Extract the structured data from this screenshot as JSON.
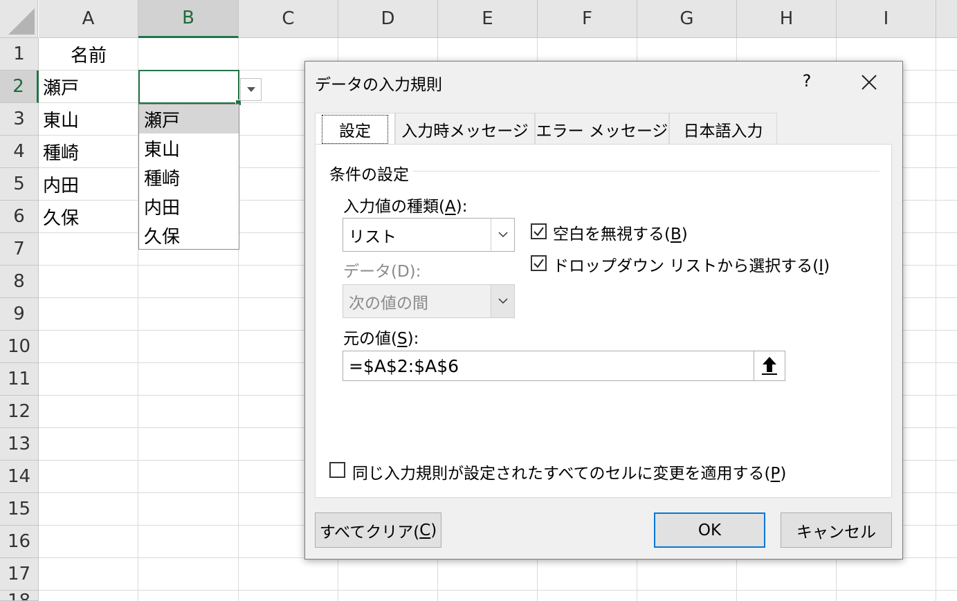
{
  "sheet": {
    "columns": [
      "A",
      "B",
      "C",
      "D",
      "E",
      "F",
      "G",
      "H",
      "I"
    ],
    "rows": [
      "1",
      "2",
      "3",
      "4",
      "5",
      "6",
      "7",
      "8",
      "9",
      "10",
      "11",
      "12",
      "13",
      "14",
      "15",
      "16",
      "17",
      "18"
    ],
    "cells": {
      "A1": "名前",
      "A2": "瀬戸",
      "A3": "東山",
      "A4": "種崎",
      "A5": "内田",
      "A6": "久保"
    },
    "active_cell": "B2",
    "dropdown_items": [
      "瀬戸",
      "東山",
      "種崎",
      "内田",
      "久保"
    ],
    "dropdown_highlighted": "瀬戸"
  },
  "dialog": {
    "title": "データの入力規則",
    "help_label": "?",
    "tabs": [
      "設定",
      "入力時メッセージ",
      "エラー メッセージ",
      "日本語入力"
    ],
    "active_tab": "設定",
    "group_title": "条件の設定",
    "allow_label_pre": "入力値の種類(",
    "allow_label_key": "A",
    "allow_label_post": "):",
    "allow_value": "リスト",
    "data_label": "データ(D):",
    "data_value": "次の値の間",
    "ignore_blank_pre": "空白を無視する(",
    "ignore_blank_key": "B",
    "ignore_blank_post": ")",
    "ignore_blank_checked": true,
    "in_cell_dropdown_pre": "ドロップダウン リストから選択する(",
    "in_cell_dropdown_key": "I",
    "in_cell_dropdown_post": ")",
    "in_cell_dropdown_checked": true,
    "source_label_pre": "元の値(",
    "source_label_key": "S",
    "source_label_post": "):",
    "source_value": "=$A$2:$A$6",
    "apply_all_pre": "同じ入力規則が設定されたすべてのセルに変更を適用する(",
    "apply_all_key": "P",
    "apply_all_post": ")",
    "apply_all_checked": false,
    "clear_all_pre": "すべてクリア(",
    "clear_all_key": "C",
    "clear_all_post": ")",
    "ok_label": "OK",
    "cancel_label": "キャンセル",
    "accent_color": "#0078d7",
    "grid_accent_color": "#217346"
  }
}
